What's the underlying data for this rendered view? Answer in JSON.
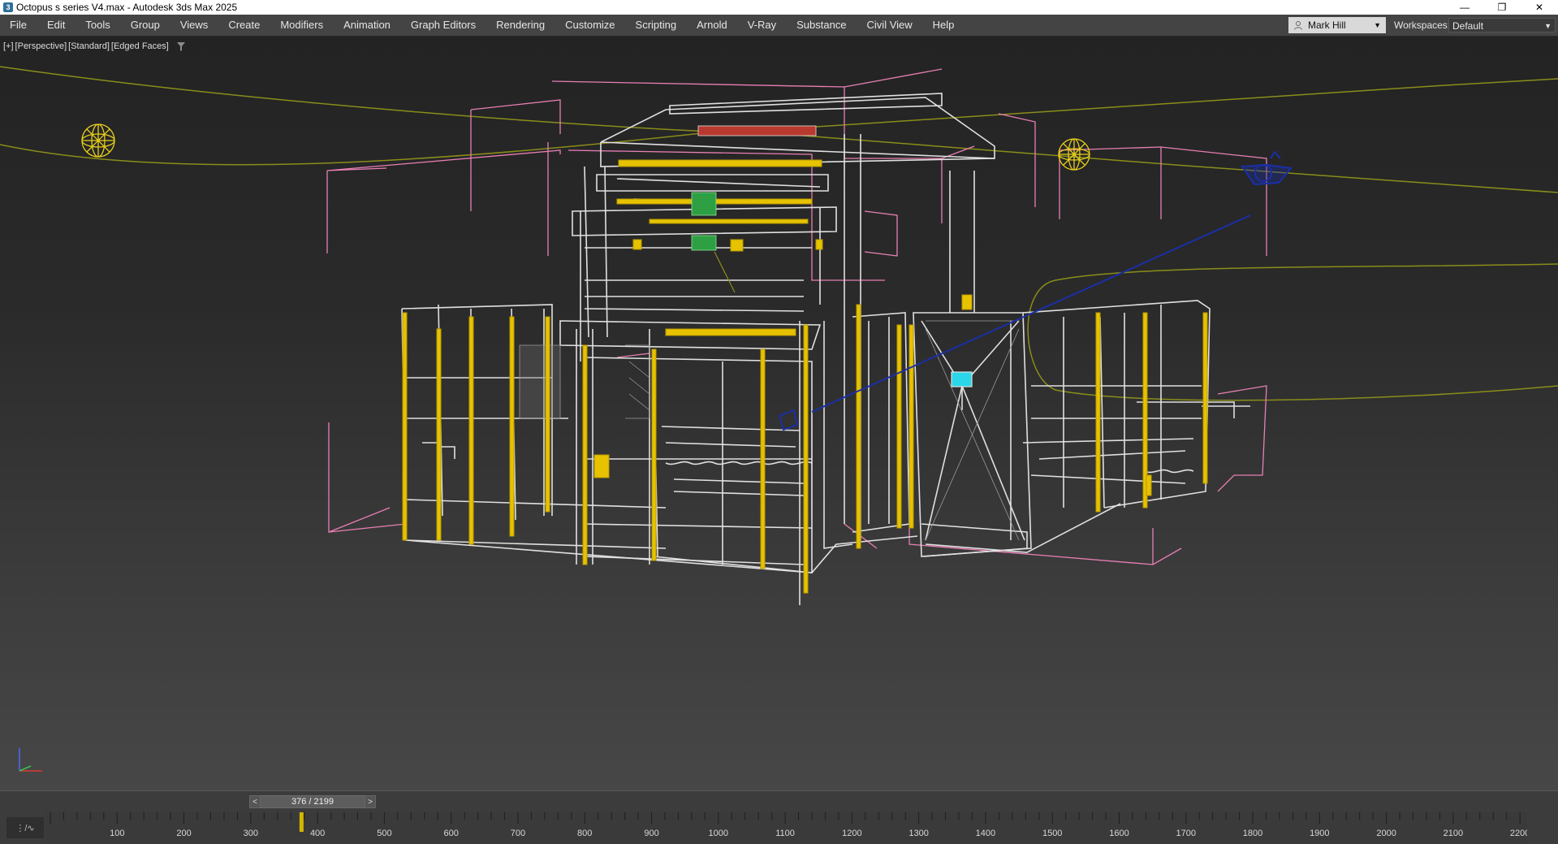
{
  "window": {
    "title": "Octopus s series V4.max - Autodesk 3ds Max 2025",
    "app_icon": "3",
    "controls": {
      "minimize": "—",
      "restore": "❐",
      "close": "✕"
    }
  },
  "menu": {
    "items": [
      "File",
      "Edit",
      "Tools",
      "Group",
      "Views",
      "Create",
      "Modifiers",
      "Animation",
      "Graph Editors",
      "Rendering",
      "Customize",
      "Scripting",
      "Arnold",
      "V-Ray",
      "Substance",
      "Civil View",
      "Help"
    ],
    "user": "Mark Hill",
    "workspaces_label": "Workspaces:",
    "workspace_value": "Default"
  },
  "viewport": {
    "label_parts": [
      "[+]",
      "[Perspective]",
      "[Standard]",
      "[Edged Faces]"
    ],
    "icons": [
      "filter-icon",
      "omni-light-icon",
      "camera-icon",
      "axis-gizmo-icon"
    ],
    "colors": {
      "frame": "#e0e0e0",
      "highlight": "#e6c200",
      "bounds": "#e87fb5",
      "path": "#8a8d1a",
      "camera": "#1a2fa8",
      "light": "#e8d01a"
    }
  },
  "timeline": {
    "frame_display": "376 / 2199",
    "prev": "<",
    "next": ">",
    "current_frame": 376,
    "total_frames": 2199,
    "track_button": "⋮/∿",
    "tick_labels": [
      "100",
      "200",
      "300",
      "400",
      "500",
      "600",
      "700",
      "800",
      "900",
      "1000",
      "1100",
      "1200",
      "1300",
      "1400",
      "1500",
      "1600",
      "1700",
      "1800",
      "1900",
      "2000",
      "2100",
      "2200"
    ]
  }
}
